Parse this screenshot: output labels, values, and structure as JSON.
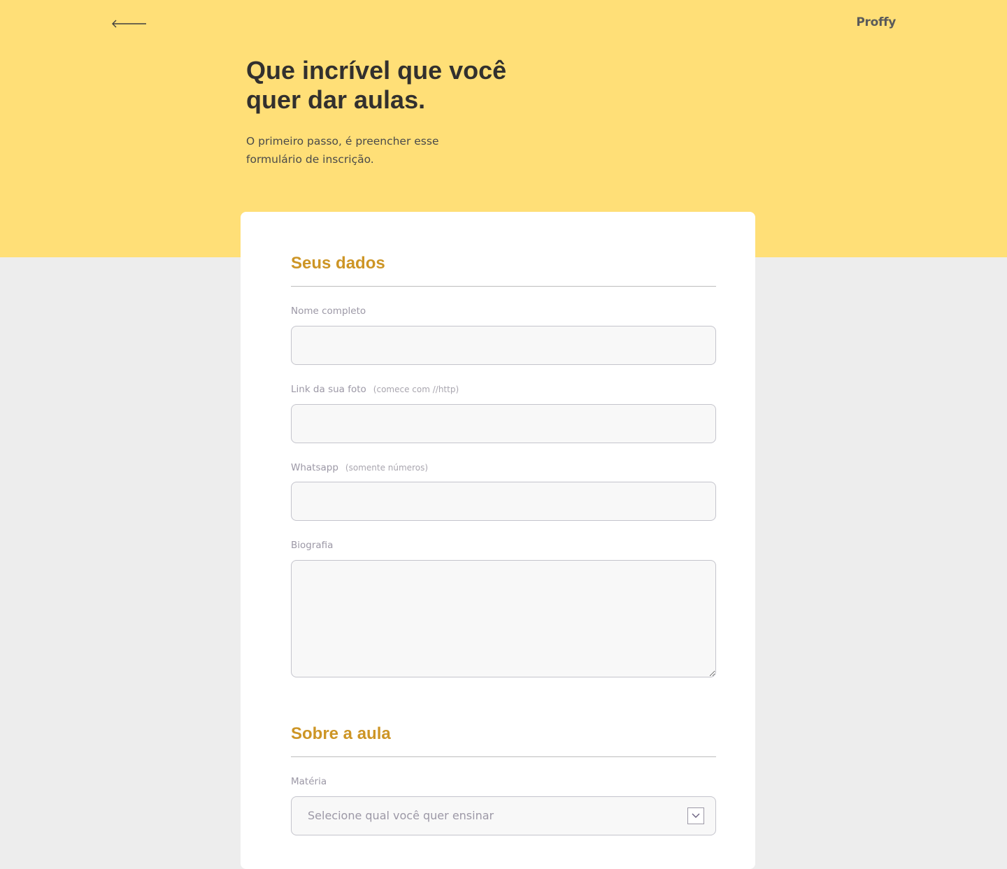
{
  "header": {
    "back_icon": "arrow-left-icon",
    "logo": "Proffy"
  },
  "hero": {
    "title_line1": "Que incrível que você",
    "title_line2": "quer dar aulas.",
    "subtitle_line1": "O primeiro passo, é preencher esse",
    "subtitle_line2": "formulário de inscrição."
  },
  "colors": {
    "hero_bg": "#FFDF77",
    "page_bg": "#EDEDED",
    "section_title": "#CD9525",
    "input_bg": "#F8F8F8",
    "input_border": "#C4C4CC"
  },
  "sections": {
    "personal": {
      "title": "Seus dados",
      "fields": {
        "name": {
          "label": "Nome completo",
          "value": ""
        },
        "photo": {
          "label": "Link da sua foto",
          "hint": "(comece com //http)",
          "value": ""
        },
        "whatsapp": {
          "label": "Whatsapp",
          "hint": "(somente números)",
          "value": ""
        },
        "bio": {
          "label": "Biografia",
          "value": ""
        }
      }
    },
    "class": {
      "title": "Sobre a aula",
      "fields": {
        "subject": {
          "label": "Matéria",
          "placeholder": "Selecione qual você quer ensinar",
          "icon": "chevron-down-icon"
        }
      }
    }
  }
}
